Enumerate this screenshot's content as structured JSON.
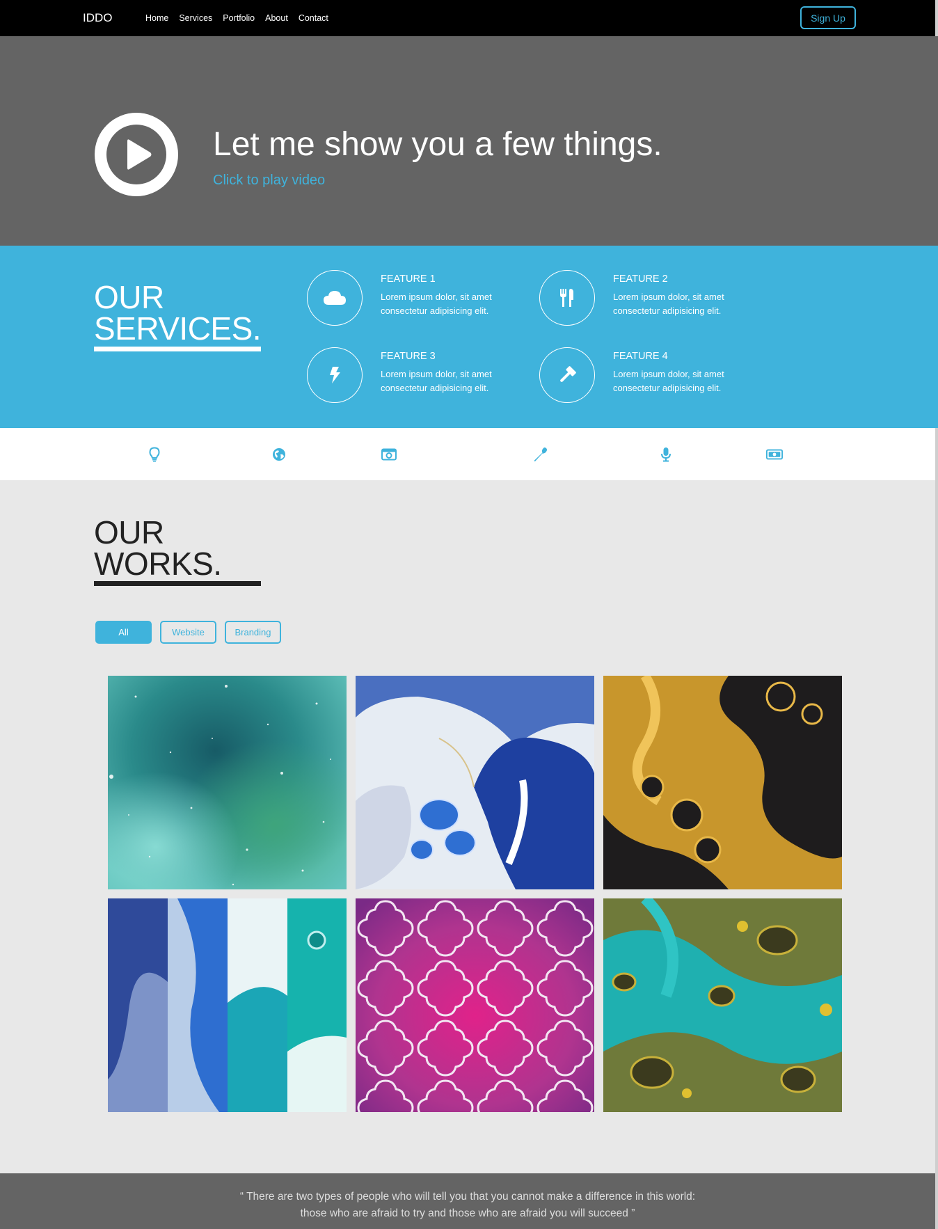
{
  "navbar": {
    "brand": "IDDO",
    "links": [
      "Home",
      "Services",
      "Portfolio",
      "About",
      "Contact"
    ],
    "signup_label": "Sign Up"
  },
  "hero": {
    "title": "Let me show you a few things.",
    "link": "Click to play video",
    "play_icon": "play-icon"
  },
  "services": {
    "title_line1": "OUR",
    "title_line2": "SERVICES.",
    "features": [
      {
        "title": "FEATURE 1",
        "text": "Lorem ipsum dolor, sit amet consectetur adipisicing elit.",
        "icon": "cloud-icon"
      },
      {
        "title": "FEATURE 2",
        "text": "Lorem ipsum dolor, sit amet consectetur adipisicing elit.",
        "icon": "utensils-icon"
      },
      {
        "title": "FEATURE 3",
        "text": "Lorem ipsum dolor, sit amet consectetur adipisicing elit.",
        "icon": "bolt-icon"
      },
      {
        "title": "FEATURE 4",
        "text": "Lorem ipsum dolor, sit amet consectetur adipisicing elit.",
        "icon": "gavel-icon"
      }
    ]
  },
  "icon_strip": [
    "lightbulb-icon",
    "globe-icon",
    "camera-icon",
    "wrench-icon",
    "microphone-icon",
    "money-icon"
  ],
  "works": {
    "title_line1": "OUR",
    "title_line2": "WORKS.",
    "filters": [
      {
        "label": "All",
        "active": true
      },
      {
        "label": "Website",
        "active": false
      },
      {
        "label": "Branding",
        "active": false
      }
    ],
    "tiles": [
      "teal watercolor galaxy",
      "blue marble acrylic",
      "gold and black fluid",
      "blue teal marble panels",
      "magenta moroccan tiles",
      "teal olive acrylic pour"
    ]
  },
  "quote": {
    "text": "“ There are two types of people who will tell you that you cannot make a difference in this world: those who are afraid to try and those who are afraid you will succeed ”"
  },
  "colors": {
    "accent": "#3fb3dc",
    "hero_bg": "#646464",
    "nav_bg": "#000000",
    "works_bg": "#e8e8e8"
  }
}
